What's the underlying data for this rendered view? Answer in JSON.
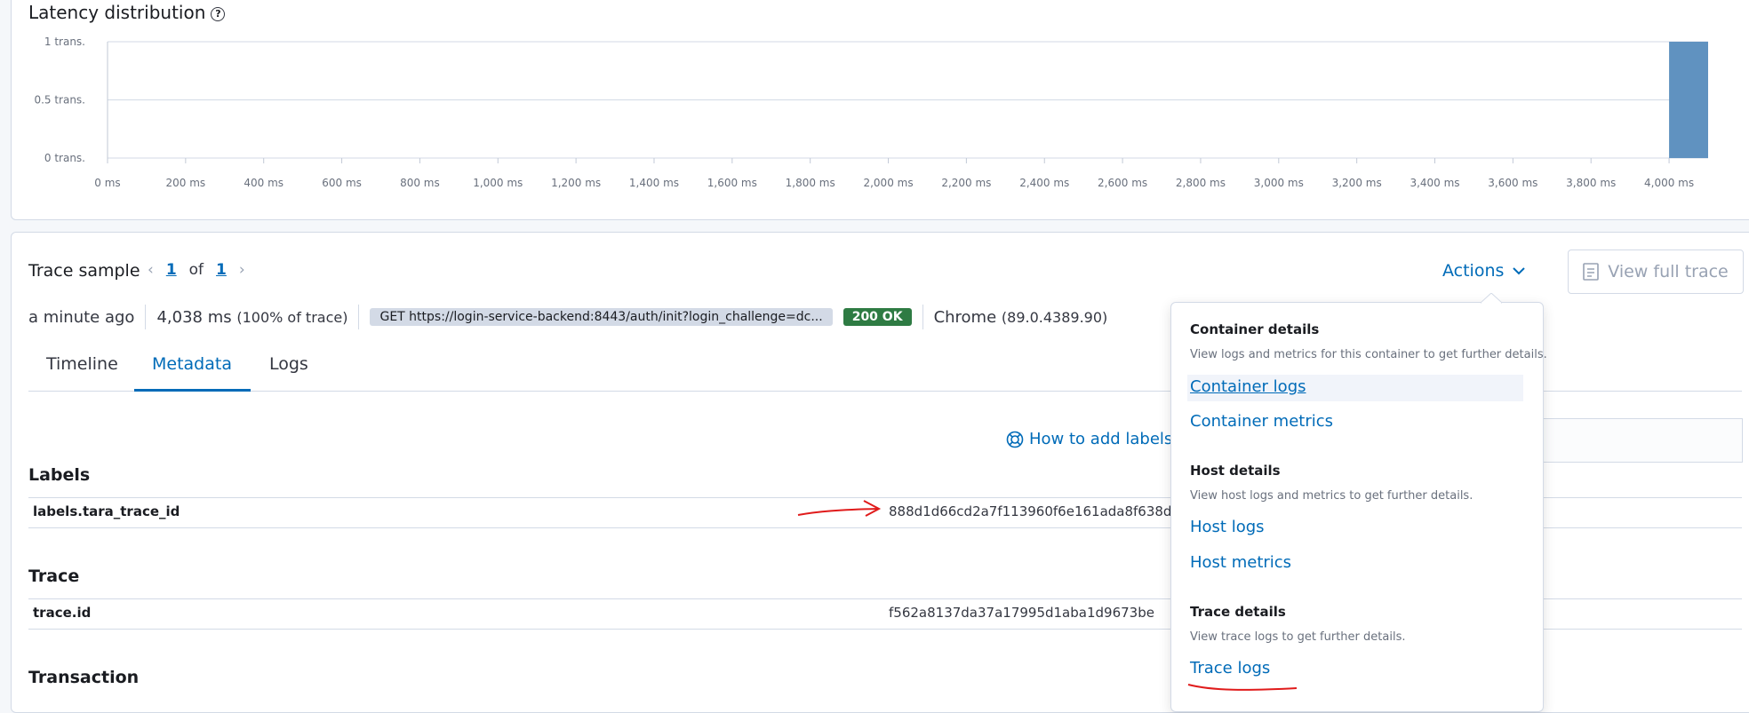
{
  "latency": {
    "title": "Latency distribution",
    "help_icon": "question-circle-icon",
    "chart_data": {
      "type": "bar",
      "title": "Latency distribution",
      "xlabel": "",
      "ylabel": "",
      "x_unit": "ms",
      "x_ticks": [
        "0 ms",
        "200 ms",
        "400 ms",
        "600 ms",
        "800 ms",
        "1,000 ms",
        "1,200 ms",
        "1,400 ms",
        "1,600 ms",
        "1,800 ms",
        "2,000 ms",
        "2,200 ms",
        "2,400 ms",
        "2,600 ms",
        "2,800 ms",
        "3,000 ms",
        "3,200 ms",
        "3,400 ms",
        "3,600 ms",
        "3,800 ms",
        "4,000 ms"
      ],
      "y_ticks": [
        "1 trans.",
        "0.5 trans.",
        "0 trans."
      ],
      "xlim": [
        0,
        4100
      ],
      "ylim": [
        0,
        1
      ],
      "bars": [
        {
          "x_start": 4000,
          "x_end": 4100,
          "value": 1
        }
      ],
      "bar_color": "#6092c0",
      "grid": true
    }
  },
  "trace": {
    "title": "Trace sample",
    "pager": {
      "current": "1",
      "of_label": "of",
      "total": "1"
    },
    "actions_label": "Actions",
    "view_full_trace_label": "View full trace",
    "summary": {
      "time_ago": "a minute ago",
      "duration": "4,038 ms",
      "duration_pct": "(100% of trace)",
      "request": "GET https://login-service-backend:8443/auth/init?login_challenge=dc...",
      "status": "200 OK",
      "browser": "Chrome",
      "browser_version": "(89.0.4389.90)"
    },
    "tabs": [
      "Timeline",
      "Metadata",
      "Logs"
    ],
    "help_link": "How to add labels a",
    "sections": {
      "labels": {
        "title": "Labels",
        "key": "labels.tara_trace_id",
        "value": "888d1d66cd2a7f113960f6e161ada8f638dec"
      },
      "trace": {
        "title": "Trace",
        "key": "trace.id",
        "value": "f562a8137da37a17995d1aba1d9673be"
      },
      "transaction": {
        "title": "Transaction"
      }
    }
  },
  "actions_menu": {
    "container": {
      "title": "Container details",
      "desc": "View logs and metrics for this container to get further details.",
      "logs": "Container logs",
      "metrics": "Container metrics"
    },
    "host": {
      "title": "Host details",
      "desc": "View host logs and metrics to get further details.",
      "logs": "Host logs",
      "metrics": "Host metrics"
    },
    "trace": {
      "title": "Trace details",
      "desc": "View trace logs to get further details.",
      "logs": "Trace logs"
    }
  },
  "colors": {
    "accent": "#006bb8",
    "success": "#2e7b43",
    "annotation": "#e01b1b",
    "bar": "#6092c0"
  }
}
